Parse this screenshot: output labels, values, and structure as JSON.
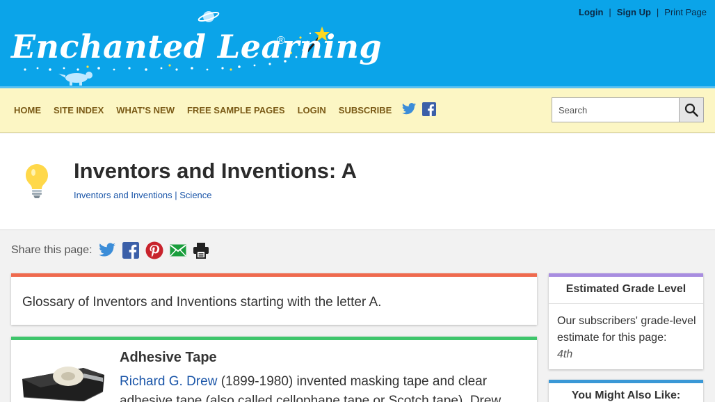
{
  "header": {
    "logo_text": "Enchanted Learning",
    "logo_reg": "®",
    "top_links": {
      "login": "Login",
      "signup": "Sign Up",
      "print": "Print Page",
      "separator": "|"
    }
  },
  "nav": {
    "items": [
      {
        "label": "HOME"
      },
      {
        "label": "SITE INDEX"
      },
      {
        "label": "WHAT'S NEW"
      },
      {
        "label": "FREE SAMPLE PAGES"
      },
      {
        "label": "LOGIN"
      },
      {
        "label": "SUBSCRIBE"
      }
    ],
    "social": [
      "twitter-icon",
      "facebook-icon"
    ],
    "search": {
      "placeholder": "Search"
    }
  },
  "page": {
    "title": "Inventors and Inventions: A",
    "breadcrumb": {
      "first": "Inventors and Inventions",
      "separator": " | ",
      "second": "Science"
    }
  },
  "share": {
    "label": "Share this page:",
    "icons": [
      "twitter-icon",
      "facebook-icon",
      "pinterest-icon",
      "email-icon",
      "print-icon"
    ]
  },
  "intro": {
    "text": "Glossary of Inventors and Inventions starting with the letter A."
  },
  "entry": {
    "title": "Adhesive Tape",
    "inventor": "Richard G. Drew",
    "text": " (1899-1980) invented masking tape and clear adhesive tape (also called cellophane tape or Scotch tape). Drew"
  },
  "grade": {
    "title": "Estimated Grade Level",
    "text": "Our subscribers' grade-level estimate for this page:",
    "value": "4th"
  },
  "also": {
    "title": "You Might Also Like:"
  },
  "colors": {
    "header_blue": "#0ba4e9",
    "nav_yellow": "#fcf6c4",
    "nav_text": "#7a5a16",
    "link_blue": "#1a55a8",
    "intro_accent": "#ef6a4e",
    "entry_accent": "#3ec56b",
    "grade_accent": "#a88de0",
    "also_accent": "#3a98d6"
  }
}
